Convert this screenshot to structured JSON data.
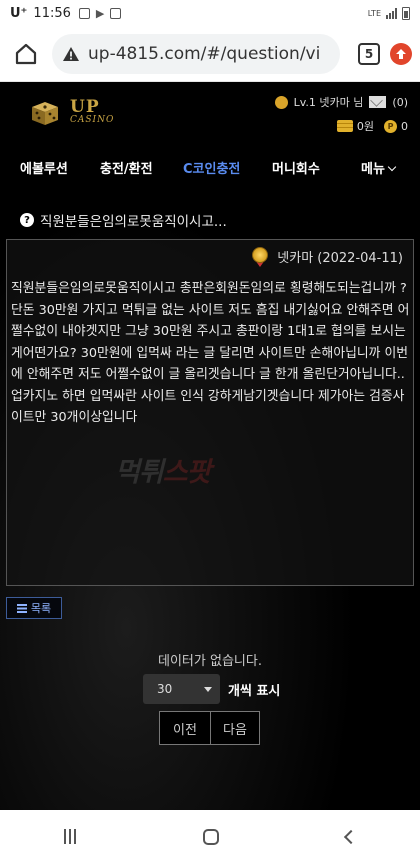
{
  "status_bar": {
    "carrier": "U⁺",
    "time": "11:56",
    "network": "LTE"
  },
  "browser": {
    "url": "up-4815.com/#/question/vi",
    "tab_count": "5"
  },
  "site": {
    "logo_main": "UP",
    "logo_sub": "CASINO",
    "user_level": "Lv.1 넷카마 님",
    "mail_count": "(0)",
    "balance": "0원",
    "points_badge": "P",
    "points": "0"
  },
  "nav": {
    "items": [
      "에볼루션",
      "충전/환전",
      "C코인충전",
      "머니회수",
      "메뉴"
    ],
    "active_index": 2,
    "active_color": "#5a8cf0"
  },
  "post": {
    "title": "직원분들은임의로못움직이시고...",
    "author_date": "넷카마 (2022-04-11)",
    "body": "직원분들은임의로못움직이시고 총판은회원돈임의로 횡령해도되는겁니까 ? 단돈 30만원 가지고 먹튀글 없는 사이트 저도 흠집 내기싫어요 안해주면 어쩔수없이 내야겟지만 그냥 30만원 주시고 총판이랑 1대1로 협의를 보시는게어떤가요? 30만원에 입먹싸 라는 글 달리면 사이트만 손해아닙니까 이번에 안해주면 저도 어쩔수없이 글 올리겟습니다 글 한개 올린단거아닙니다.. 업카지노 하면 입먹싸란 사이트 인식 강하게남기겟습니다 제가아는 검증사이트만 30개이상입니다",
    "watermark_a": "먹튀",
    "watermark_b": "스팟"
  },
  "list_button": "목록",
  "empty_message": "데이터가 없습니다.",
  "page_size": {
    "selected": "30",
    "label": "개씩 표시"
  },
  "pager": {
    "prev": "이전",
    "next": "다음"
  }
}
